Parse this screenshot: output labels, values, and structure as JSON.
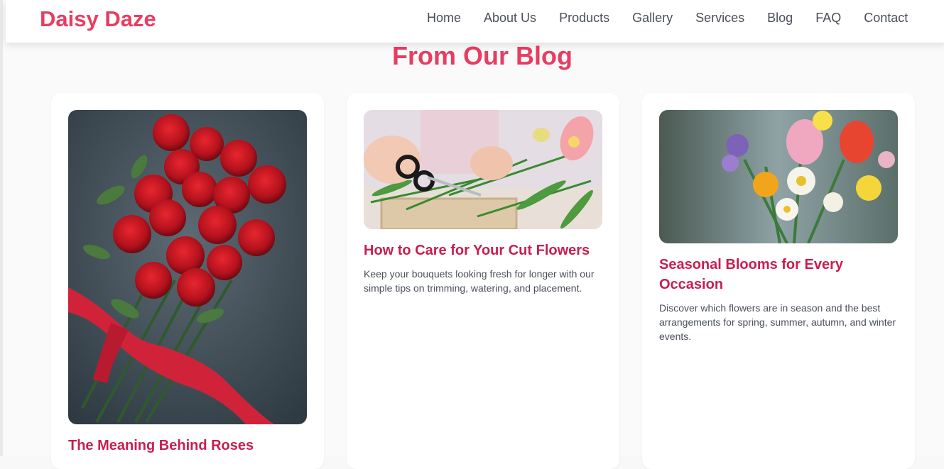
{
  "header": {
    "brand": "Daisy Daze",
    "nav": [
      "Home",
      "About Us",
      "Products",
      "Gallery",
      "Services",
      "Blog",
      "FAQ",
      "Contact"
    ]
  },
  "section": {
    "title": "From Our Blog"
  },
  "posts": [
    {
      "title": "The Meaning Behind Roses",
      "excerpt": "",
      "image": "red-roses-bouquet-image"
    },
    {
      "title": "How to Care for Your Cut Flowers",
      "excerpt": "Keep your bouquets looking fresh for longer with our simple tips on trimming, watering, and placement.",
      "image": "trimming-flower-stems-image"
    },
    {
      "title": "Seasonal Blooms for Every Occasion",
      "excerpt": "Discover which flowers are in season and the best arrangements for spring, summer, autumn, and winter events.",
      "image": "mixed-spring-bouquet-image"
    }
  ],
  "colors": {
    "brand": "#e73d62",
    "post_title": "#c81e4f",
    "body_text": "#4a4f5a"
  }
}
